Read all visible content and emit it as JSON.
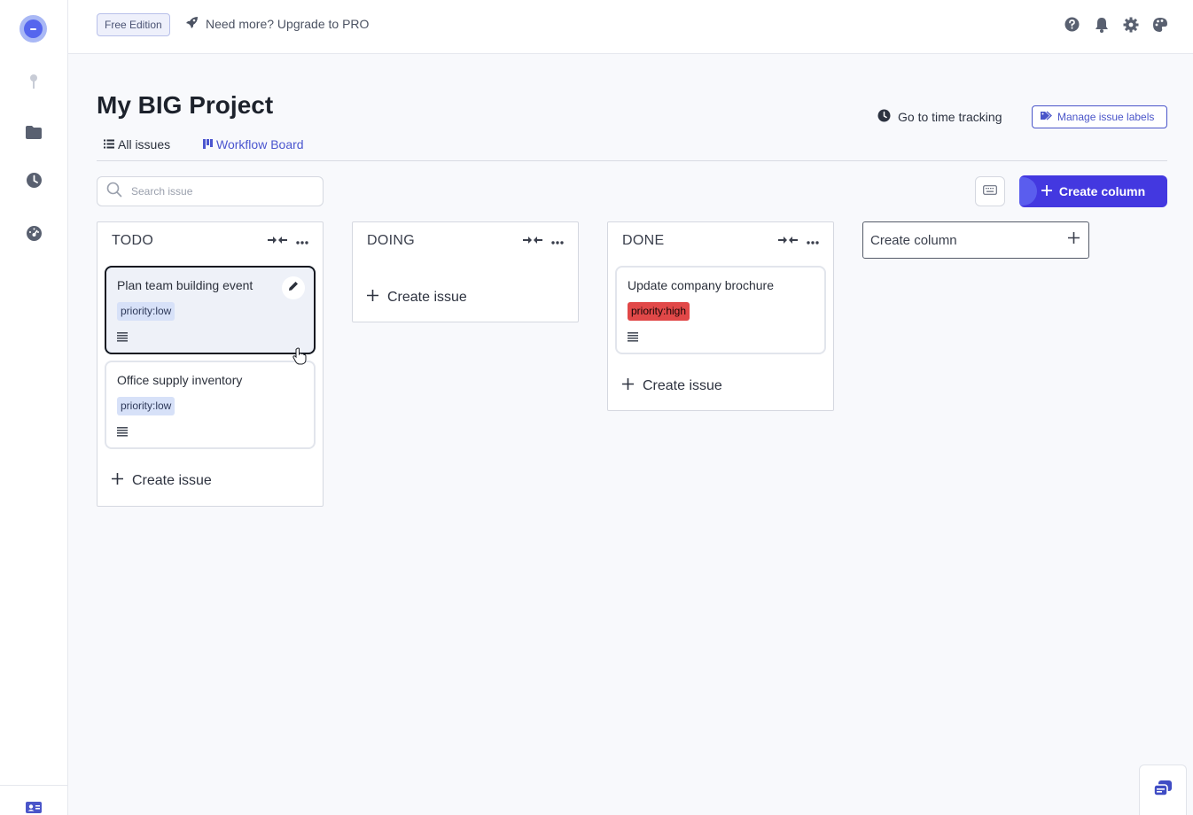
{
  "topbar": {
    "edition": "Free Edition",
    "upgrade": "Need more? Upgrade to PRO"
  },
  "header": {
    "title": "My BIG Project",
    "time_tracking": "Go to time tracking",
    "manage_labels": "Manage issue labels"
  },
  "tabs": [
    {
      "label": "All issues"
    },
    {
      "label": "Workflow Board"
    }
  ],
  "toolbar": {
    "search_placeholder": "Search issue",
    "create_column": "Create column"
  },
  "columns": [
    {
      "title": "TODO",
      "cards": [
        {
          "title": "Plan team building event",
          "label": "priority:low"
        },
        {
          "title": "Office supply inventory",
          "label": "priority:low"
        }
      ],
      "create_issue": "Create issue"
    },
    {
      "title": "DOING",
      "cards": [],
      "create_issue": "Create issue"
    },
    {
      "title": "DONE",
      "cards": [
        {
          "title": "Update company brochure",
          "label": "priority:high"
        }
      ],
      "create_issue": "Create issue"
    }
  ],
  "new_column": {
    "placeholder": "Create column"
  },
  "colors": {
    "primary": "#4338e0",
    "link": "#4b56cf",
    "label_low": "#d7e1f8",
    "label_high": "#e14848"
  }
}
